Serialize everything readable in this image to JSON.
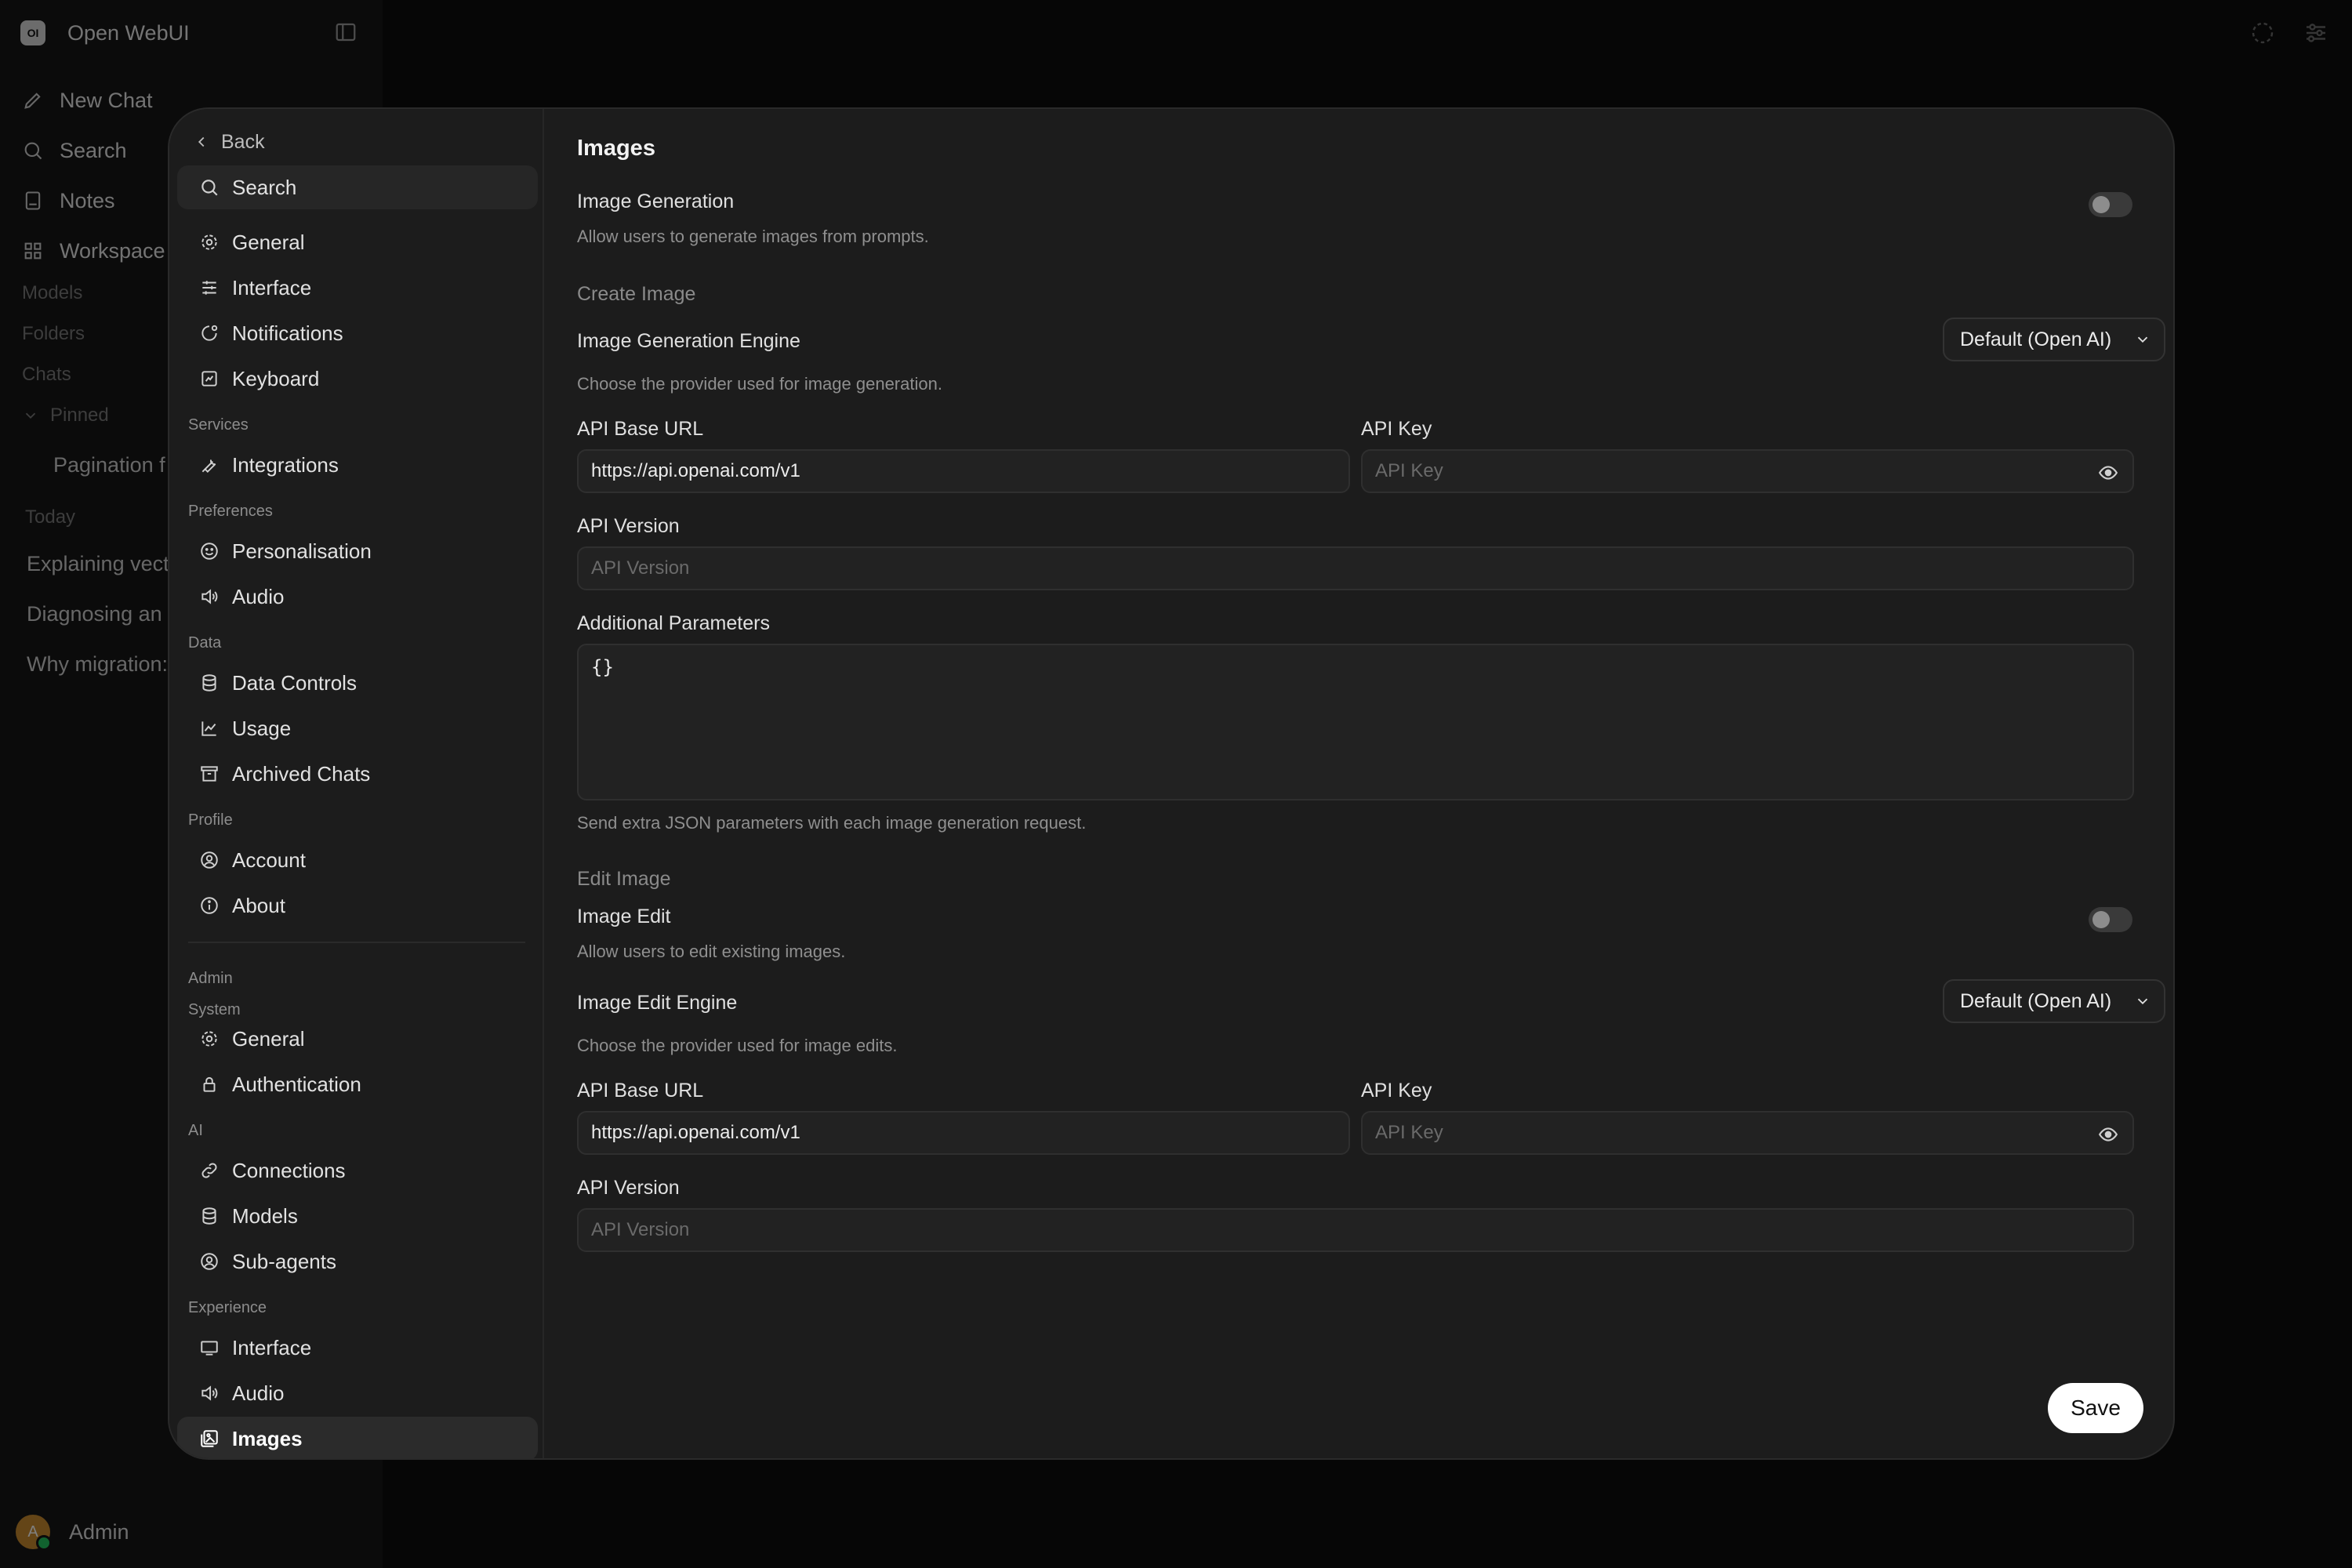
{
  "app": {
    "logo_text": "OI",
    "name": "Open WebUI",
    "nav": [
      {
        "label": "New Chat",
        "icon": "pencil-icon"
      },
      {
        "label": "Search",
        "icon": "search-icon"
      },
      {
        "label": "Notes",
        "icon": "note-icon"
      },
      {
        "label": "Workspace",
        "icon": "grid-icon"
      }
    ],
    "sections": {
      "models": "Models",
      "folders": "Folders",
      "chats": "Chats",
      "pinned": "Pinned",
      "today": "Today"
    },
    "pinned_chat": "Pagination f",
    "today_chats": [
      "Explaining vect",
      "Diagnosing an",
      "Why migration:"
    ],
    "user": {
      "initial": "A",
      "name": "Admin"
    }
  },
  "settings_nav": {
    "back": "Back",
    "search": "Search",
    "items": {
      "general": "General",
      "interface": "Interface",
      "notifications": "Notifications",
      "keyboard": "Keyboard",
      "services": "Services",
      "integrations": "Integrations",
      "preferences": "Preferences",
      "personalisation": "Personalisation",
      "audio": "Audio",
      "data": "Data",
      "data_controls": "Data Controls",
      "usage": "Usage",
      "archived_chats": "Archived Chats",
      "profile": "Profile",
      "account": "Account",
      "about": "About",
      "admin": "Admin",
      "system": "System",
      "admin_general": "General",
      "authentication": "Authentication",
      "ai": "AI",
      "connections": "Connections",
      "models": "Models",
      "sub_agents": "Sub-agents",
      "experience": "Experience",
      "exp_interface": "Interface",
      "exp_audio": "Audio",
      "images": "Images"
    }
  },
  "content": {
    "title": "Images",
    "image_generation": {
      "label": "Image Generation",
      "hint": "Allow users to generate images from prompts.",
      "enabled": false
    },
    "create_image": {
      "section": "Create Image",
      "engine_label": "Image Generation Engine",
      "engine_hint": "Choose the provider used for image generation.",
      "engine_value": "Default (Open AI)",
      "api_base_url_label": "API Base URL",
      "api_base_url_value": "https://api.openai.com/v1",
      "api_key_label": "API Key",
      "api_key_placeholder": "API Key",
      "api_version_label": "API Version",
      "api_version_placeholder": "API Version",
      "additional_params_label": "Additional Parameters",
      "additional_params_value": "{}",
      "additional_params_hint": "Send extra JSON parameters with each image generation request."
    },
    "edit_image": {
      "section": "Edit Image",
      "label": "Image Edit",
      "hint": "Allow users to edit existing images.",
      "enabled": false,
      "engine_label": "Image Edit Engine",
      "engine_hint": "Choose the provider used for image edits.",
      "engine_value": "Default (Open AI)",
      "api_base_url_label": "API Base URL",
      "api_base_url_value": "https://api.openai.com/v1",
      "api_key_label": "API Key",
      "api_key_placeholder": "API Key",
      "api_version_label": "API Version",
      "api_version_placeholder": "API Version"
    },
    "save_label": "Save"
  }
}
